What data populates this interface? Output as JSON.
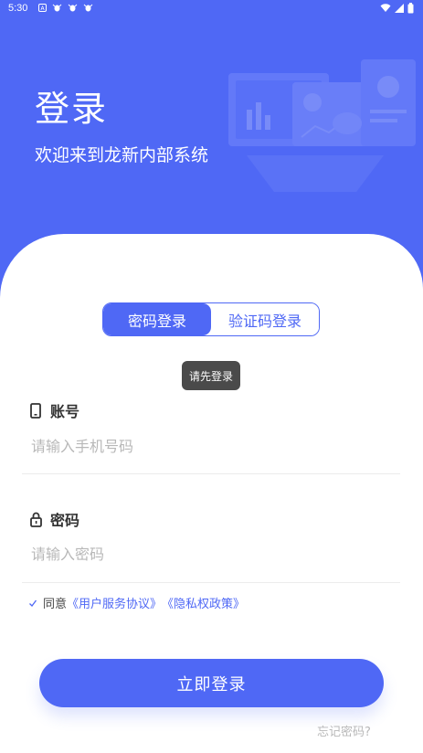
{
  "status_bar": {
    "time": "5:30",
    "icons": [
      "android-notification-icon",
      "bug-icon",
      "bug-icon",
      "bug-icon",
      "wifi-icon",
      "signal-icon",
      "battery-icon"
    ]
  },
  "hero": {
    "title": "登录",
    "subtitle": "欢迎来到龙新内部系统"
  },
  "tabs": {
    "password_login": "密码登录",
    "code_login": "验证码登录",
    "active": "password_login"
  },
  "toast": {
    "text": "请先登录"
  },
  "account": {
    "label": "账号",
    "placeholder": "请输入手机号码",
    "value": ""
  },
  "password": {
    "label": "密码",
    "placeholder": "请输入密码",
    "value": ""
  },
  "agreement": {
    "checked": true,
    "prefix": "同意",
    "user_agreement": "《用户服务协议》",
    "privacy_policy": "《隐私权政策》"
  },
  "actions": {
    "login": "立即登录",
    "forgot_password": "忘记密码?"
  },
  "colors": {
    "primary": "#4f68f5",
    "placeholder": "#b8b8b8",
    "toast_bg": "#4a4a4a"
  }
}
